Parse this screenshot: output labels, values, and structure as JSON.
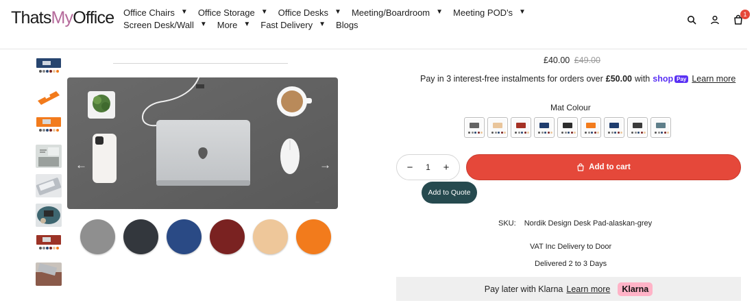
{
  "header": {
    "logo": {
      "part1": "Thats",
      "part2": "My",
      "part3": "Office"
    },
    "nav": [
      {
        "label": "Office Chairs",
        "dropdown": true
      },
      {
        "label": "Office Storage",
        "dropdown": true
      },
      {
        "label": "Office Desks",
        "dropdown": true
      },
      {
        "label": "Meeting/Boardroom",
        "dropdown": true
      },
      {
        "label": "Meeting POD's",
        "dropdown": true
      },
      {
        "label": "Screen Desk/Wall",
        "dropdown": true
      },
      {
        "label": "More",
        "dropdown": true
      },
      {
        "label": "Fast Delivery",
        "dropdown": true
      },
      {
        "label": "Blogs",
        "dropdown": false
      }
    ],
    "cart_count": "1",
    "icons": [
      "search-icon",
      "account-icon",
      "cart-icon"
    ]
  },
  "gallery": {
    "thumbnail_count": 8,
    "circle_swatch_colors": [
      "#8f8f8f",
      "#33373d",
      "#2a4a85",
      "#7a2221",
      "#eec79a",
      "#f27b1c"
    ],
    "prev_arrow": "←",
    "next_arrow": "→"
  },
  "product": {
    "price": "£40.00",
    "compare_price": "£49.00",
    "installments": {
      "text_before": "Pay in 3 interest-free instalments for orders over",
      "amount": "£50.00",
      "text_after": "with",
      "provider": "shop",
      "provider_tag": "Pay",
      "link": "Learn more"
    },
    "mat_colour_label": "Mat Colour",
    "mat_swatch_colors": [
      "#646464",
      "#e9c59b",
      "#a53125",
      "#1f3d6e",
      "#2c2c2c",
      "#f27b1c",
      "#1f3d6e",
      "#3b3b3b",
      "#5f7f8a"
    ],
    "quantity": "1",
    "qty_minus": "−",
    "qty_plus": "+",
    "add_to_cart": "Add to cart",
    "add_to_quote": "Add to Quote",
    "sku_label": "SKU:",
    "sku_value": "Nordik Design Desk Pad-alaskan-grey",
    "vat_text": "VAT Inc Delivery to Door",
    "delivery_text": "Delivered 2 to 3 Days",
    "klarna": {
      "text": "Pay later with Klarna",
      "link": "Learn more",
      "badge": "Klarna"
    }
  },
  "colors": {
    "accent": "#e5483a",
    "quote_button": "#264a4f",
    "klarna_pink": "#ffb3c7"
  }
}
